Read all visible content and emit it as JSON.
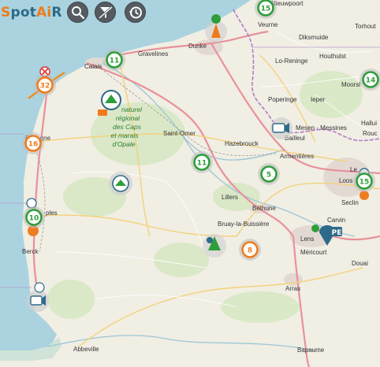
{
  "app": {
    "logo": {
      "prefix": "S",
      "middle": "pot",
      "a": "Ai",
      "suffix": "R"
    },
    "toolbar": [
      {
        "name": "search-button",
        "icon": "search-icon"
      },
      {
        "name": "filter-off-button",
        "icon": "filter-off-icon"
      },
      {
        "name": "history-button",
        "icon": "history-icon"
      }
    ]
  },
  "colors": {
    "water": "#aad3df",
    "land": "#f1eee4",
    "green_cluster": "#2e9e3a",
    "orange_cluster": "#ee7d1f",
    "border": "#b07cc6"
  },
  "places": [
    {
      "id": "nieuwpoort",
      "text": "Nieuwpoort"
    },
    {
      "id": "veurne",
      "text": "Veurne"
    },
    {
      "id": "diksmuide",
      "text": "Diksmuide"
    },
    {
      "id": "torhout",
      "text": "Torhout"
    },
    {
      "id": "houthulst",
      "text": "Houthulst"
    },
    {
      "id": "lo-reninge",
      "text": "Lo-Reninge"
    },
    {
      "id": "dunkerque",
      "text": "Dunke"
    },
    {
      "id": "gravelines",
      "text": "Gravelines"
    },
    {
      "id": "calais",
      "text": "Calais"
    },
    {
      "id": "moorsl",
      "text": "Moorsl"
    },
    {
      "id": "poperinge",
      "text": "Poperinge"
    },
    {
      "id": "ieper",
      "text": "Ieper"
    },
    {
      "id": "mesen",
      "text": "Mesen - Messines"
    },
    {
      "id": "hallu",
      "text": "Hallui"
    },
    {
      "id": "rouc",
      "text": "Rouc"
    },
    {
      "id": "saint-omer",
      "text": "Saint-Omer"
    },
    {
      "id": "hazebrouck",
      "text": "Hazebrouck"
    },
    {
      "id": "bailleul",
      "text": "Bailleul"
    },
    {
      "id": "armentieres",
      "text": "Armentières"
    },
    {
      "id": "le",
      "text": "Le"
    },
    {
      "id": "loos",
      "text": "Loos"
    },
    {
      "id": "boulogne",
      "text": "Bo    gne"
    },
    {
      "id": "lillers",
      "text": "Lillers"
    },
    {
      "id": "bethune",
      "text": "Béthune"
    },
    {
      "id": "seclin",
      "text": "Seclin"
    },
    {
      "id": "bruay",
      "text": "Bruay-la-Buissière"
    },
    {
      "id": "carvin",
      "text": "Carvin"
    },
    {
      "id": "etaples",
      "text": "ples"
    },
    {
      "id": "lens",
      "text": "Lens"
    },
    {
      "id": "mericourt",
      "text": "Méricourt"
    },
    {
      "id": "douai",
      "text": "Douai"
    },
    {
      "id": "berck",
      "text": "Berck"
    },
    {
      "id": "arras",
      "text": "Arras"
    },
    {
      "id": "abbeville",
      "text": "Abbeville"
    },
    {
      "id": "bapaume",
      "text": "Bapaume"
    }
  ],
  "park_label": {
    "lines": [
      "naturel",
      "régional",
      "des Caps",
      "et marais",
      "d'Opale"
    ]
  },
  "clusters": [
    {
      "id": "c15-top",
      "count": "15",
      "color": "green"
    },
    {
      "id": "c11-calais",
      "count": "11",
      "color": "green"
    },
    {
      "id": "c32",
      "count": "32",
      "color": "orange"
    },
    {
      "id": "c16",
      "count": "16",
      "color": "orange"
    },
    {
      "id": "c11-saintomer",
      "count": "11",
      "color": "green"
    },
    {
      "id": "c5",
      "count": "5",
      "color": "green"
    },
    {
      "id": "c14",
      "count": "14",
      "color": "green"
    },
    {
      "id": "c15-lille",
      "count": "15",
      "color": "green"
    },
    {
      "id": "c10",
      "count": "10",
      "color": "green"
    },
    {
      "id": "c8",
      "count": "8",
      "color": "orange"
    }
  ],
  "badges": {
    "pe": "PE"
  }
}
